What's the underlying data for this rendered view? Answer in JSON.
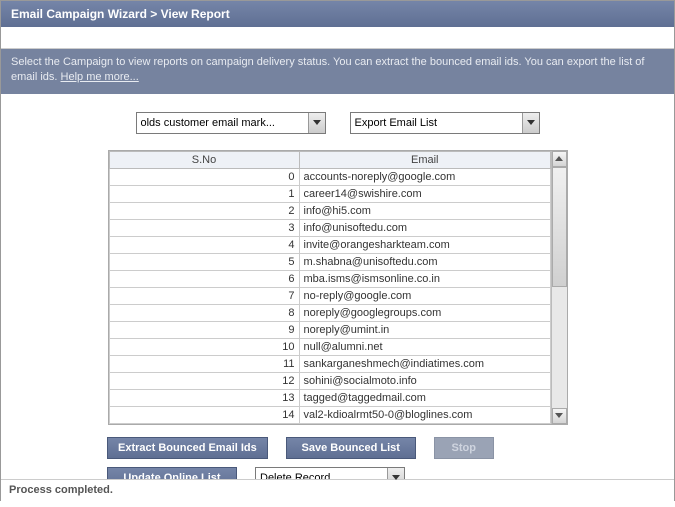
{
  "title": "Email Campaign Wizard > View Report",
  "info_text": "Select the Campaign to view reports on campaign delivery status. You can extract the bounced email ids. You can export the list of email ids. ",
  "help_link": "Help me more...",
  "select_campaign": "olds customer email mark...",
  "select_export": "Export Email List",
  "columns": {
    "sno": "S.No",
    "email": "Email"
  },
  "rows": [
    {
      "sno": "0",
      "email": "accounts-noreply@google.com"
    },
    {
      "sno": "1",
      "email": "career14@swishire.com"
    },
    {
      "sno": "2",
      "email": "info@hi5.com"
    },
    {
      "sno": "3",
      "email": "info@unisoftedu.com"
    },
    {
      "sno": "4",
      "email": "invite@orangesharkteam.com"
    },
    {
      "sno": "5",
      "email": "m.shabna@unisoftedu.com"
    },
    {
      "sno": "6",
      "email": "mba.isms@ismsonline.co.in"
    },
    {
      "sno": "7",
      "email": "no-reply@google.com"
    },
    {
      "sno": "8",
      "email": "noreply@googlegroups.com"
    },
    {
      "sno": "9",
      "email": "noreply@umint.in"
    },
    {
      "sno": "10",
      "email": "null@alumni.net"
    },
    {
      "sno": "11",
      "email": "sankarganeshmech@indiatimes.com"
    },
    {
      "sno": "12",
      "email": "sohini@socialmoto.info"
    },
    {
      "sno": "13",
      "email": "tagged@taggedmail.com"
    },
    {
      "sno": "14",
      "email": "val2-kdioalrmt50-0@bloglines.com"
    }
  ],
  "buttons": {
    "extract": "Extract Bounced Email Ids",
    "save": "Save Bounced List",
    "stop": "Stop",
    "update": "Update Online List",
    "delete": "Delete Record"
  },
  "status": "Process completed."
}
